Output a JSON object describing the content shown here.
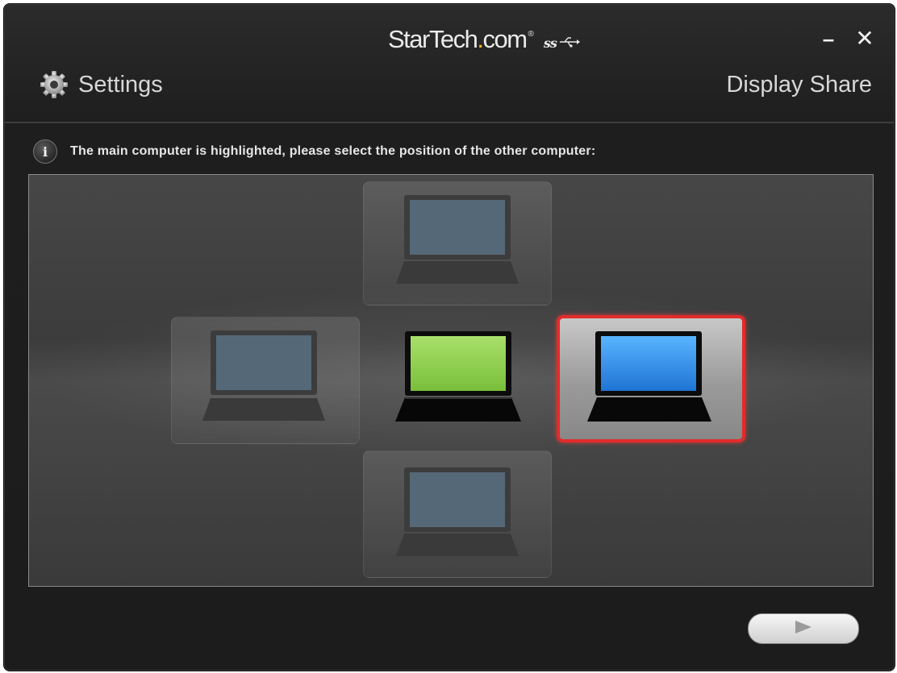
{
  "window": {
    "brand": "StarTech",
    "brand_dot": ".",
    "brand_suffix": "com",
    "ss_label": "ss",
    "settings_label": "Settings",
    "title": "Display Share",
    "minimize_label": "–",
    "close_label": "✕"
  },
  "info": {
    "icon_label": "i",
    "message": "The main computer is highlighted, please select the position of the other computer:"
  },
  "positions": [
    {
      "name": "top",
      "state": "available"
    },
    {
      "name": "left",
      "state": "available"
    },
    {
      "name": "main",
      "state": "main"
    },
    {
      "name": "right",
      "state": "selected"
    },
    {
      "name": "bottom",
      "state": "available"
    }
  ],
  "colors": {
    "main_screen": "#8ccc4e",
    "selected_screen": "#2f8fe6",
    "dim_screen": "#556878",
    "selection_border": "#e22b2b",
    "brand_dot": "#f6b81e"
  },
  "icons": {
    "settings": "gear-icon",
    "info": "info-icon",
    "next": "play-arrow-icon",
    "usb": "usb-icon"
  }
}
